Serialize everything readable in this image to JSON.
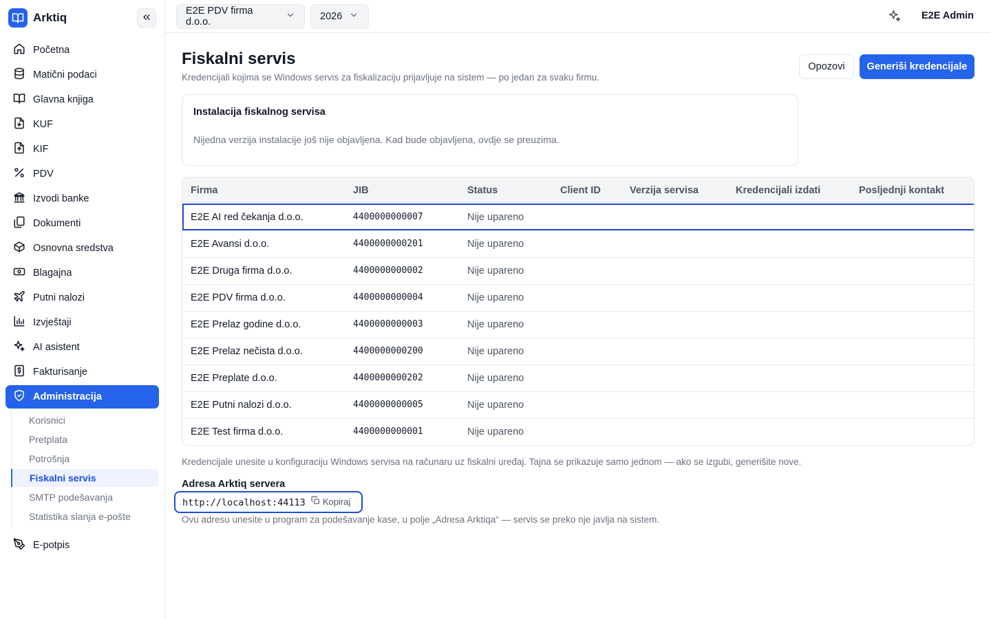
{
  "brand": {
    "name": "Arktiq"
  },
  "sidebar": {
    "items": [
      {
        "label": "Početna",
        "icon": "home-icon"
      },
      {
        "label": "Matični podaci",
        "icon": "database-icon"
      },
      {
        "label": "Glavna knjiga",
        "icon": "book-icon"
      },
      {
        "label": "KUF",
        "icon": "file-in-icon"
      },
      {
        "label": "KIF",
        "icon": "file-out-icon"
      },
      {
        "label": "PDV",
        "icon": "percent-icon"
      },
      {
        "label": "Izvodi banke",
        "icon": "bank-icon"
      },
      {
        "label": "Dokumenti",
        "icon": "documents-icon"
      },
      {
        "label": "Osnovna sredstva",
        "icon": "box-icon"
      },
      {
        "label": "Blagajna",
        "icon": "cash-icon"
      },
      {
        "label": "Putni nalozi",
        "icon": "plane-icon"
      },
      {
        "label": "Izvještaji",
        "icon": "chart-icon"
      },
      {
        "label": "AI asistent",
        "icon": "sparkle-icon"
      },
      {
        "label": "Fakturisanje",
        "icon": "invoice-icon"
      },
      {
        "label": "Administracija",
        "icon": "shield-icon",
        "active": true
      }
    ],
    "sub_items": [
      {
        "label": "Korisnici"
      },
      {
        "label": "Pretplata"
      },
      {
        "label": "Potrošnja"
      },
      {
        "label": "Fiskalni servis",
        "active": true
      },
      {
        "label": "SMTP podešavanja"
      },
      {
        "label": "Statistika slanja e-pošte"
      }
    ],
    "after_items": [
      {
        "label": "E-potpis",
        "icon": "pen-icon"
      }
    ]
  },
  "topbar": {
    "firm": "E2E PDV firma d.o.o.",
    "year": "2026",
    "user": "E2E Admin"
  },
  "page": {
    "title": "Fiskalni servis",
    "subtitle": "Kredencijali kojima se Windows servis za fiskalizaciju prijavljuje na sistem — po jedan za svaku firmu.",
    "revoke_label": "Opozovi",
    "generate_label": "Generiši kredencijale"
  },
  "install": {
    "title": "Instalacija fiskalnog servisa",
    "text": "Nijedna verzija instalacije još nije objavljena. Kad bude objavljena, ovdje se preuzima."
  },
  "table": {
    "columns": [
      "Firma",
      "JIB",
      "Status",
      "Client ID",
      "Verzija servisa",
      "Kredencijali izdati",
      "Posljednji kontakt"
    ],
    "rows": [
      {
        "firma": "E2E AI red čekanja d.o.o.",
        "jib": "4400000000007",
        "status": "Nije upareno",
        "client_id": "",
        "version": "",
        "issued": "",
        "last": ""
      },
      {
        "firma": "E2E Avansi d.o.o.",
        "jib": "4400000000201",
        "status": "Nije upareno",
        "client_id": "",
        "version": "",
        "issued": "",
        "last": ""
      },
      {
        "firma": "E2E Druga firma d.o.o.",
        "jib": "4400000000002",
        "status": "Nije upareno",
        "client_id": "",
        "version": "",
        "issued": "",
        "last": ""
      },
      {
        "firma": "E2E PDV firma d.o.o.",
        "jib": "4400000000004",
        "status": "Nije upareno",
        "client_id": "",
        "version": "",
        "issued": "",
        "last": ""
      },
      {
        "firma": "E2E Prelaz godine d.o.o.",
        "jib": "4400000000003",
        "status": "Nije upareno",
        "client_id": "",
        "version": "",
        "issued": "",
        "last": ""
      },
      {
        "firma": "E2E Prelaz nečista d.o.o.",
        "jib": "4400000000200",
        "status": "Nije upareno",
        "client_id": "",
        "version": "",
        "issued": "",
        "last": ""
      },
      {
        "firma": "E2E Preplate d.o.o.",
        "jib": "4400000000202",
        "status": "Nije upareno",
        "client_id": "",
        "version": "",
        "issued": "",
        "last": ""
      },
      {
        "firma": "E2E Putni nalozi d.o.o.",
        "jib": "4400000000005",
        "status": "Nije upareno",
        "client_id": "",
        "version": "",
        "issued": "",
        "last": ""
      },
      {
        "firma": "E2E Test firma d.o.o.",
        "jib": "4400000000001",
        "status": "Nije upareno",
        "client_id": "",
        "version": "",
        "issued": "",
        "last": ""
      }
    ]
  },
  "footer": {
    "note": "Kredencijale unesite u konfiguraciju Windows servisa na računaru uz fiskalni uređaj. Tajna se prikazuje samo jednom — ako se izgubi, generišite nove.",
    "server_label": "Adresa Arktiq servera",
    "server_url": "http://localhost:44113",
    "copy_label": "Kopiraj",
    "server_hint": "Ovu adresu unesite u program za podešavanje kase, u polje „Adresa Arktiqa“ — servis se preko nje javlja na sistem."
  },
  "colors": {
    "accent": "#2563eb",
    "focus": "#1d4ed8",
    "muted": "#6b7280",
    "border": "#e5e7eb"
  }
}
